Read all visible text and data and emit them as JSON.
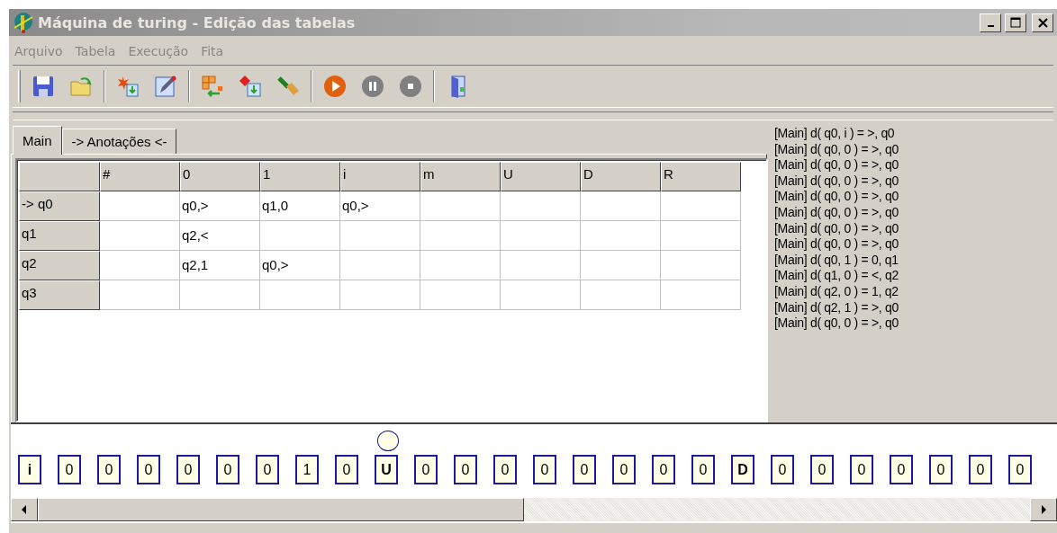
{
  "window": {
    "title": "Máquina de turing - Edição das tabelas"
  },
  "menu": [
    {
      "label": "Arquivo",
      "disabled": true
    },
    {
      "label": "Tabela",
      "disabled": true
    },
    {
      "label": "Execução",
      "disabled": true
    },
    {
      "label": "Fita",
      "disabled": true
    }
  ],
  "tabs": [
    {
      "label": "Main",
      "selected": true
    },
    {
      "label": "-> Anotações <-",
      "selected": false
    }
  ],
  "table": {
    "columns": [
      "#",
      "0",
      "1",
      "i",
      "m",
      "U",
      "D",
      "R"
    ],
    "rows": [
      {
        "state": "-> q0",
        "cells": [
          null,
          "q0,>",
          "q1,0",
          "q0,>",
          null,
          null,
          null,
          null
        ]
      },
      {
        "state": "q1",
        "cells": [
          null,
          "q2,<",
          null,
          null,
          null,
          null,
          null,
          null
        ]
      },
      {
        "state": "q2",
        "cells": [
          null,
          "q2,1",
          "q0,>",
          null,
          null,
          null,
          null,
          null
        ]
      },
      {
        "state": "q3",
        "cells": [
          null,
          null,
          null,
          null,
          null,
          null,
          null,
          null
        ]
      }
    ]
  },
  "log": [
    "[Main] d( q0, i ) = >, q0",
    "[Main] d( q0, 0 ) = >, q0",
    "[Main] d( q0, 0 ) = >, q0",
    "[Main] d( q0, 0 ) = >, q0",
    "[Main] d( q0, 0 ) = >, q0",
    "[Main] d( q0, 0 ) = >, q0",
    "[Main] d( q0, 0 ) = >, q0",
    "[Main] d( q0, 0 ) = >, q0",
    "[Main] d( q0, 1 ) = 0, q1",
    "[Main] d( q1, 0 ) = <, q2",
    "[Main] d( q2, 0 ) = 1, q2",
    "[Main] d( q2, 1 ) = >, q0",
    "[Main] d( q0, 0 ) = >, q0"
  ],
  "tape": [
    {
      "symbol": "i",
      "bold": true,
      "selected": false
    },
    {
      "symbol": "0",
      "bold": false,
      "selected": false
    },
    {
      "symbol": "0",
      "bold": false,
      "selected": false
    },
    {
      "symbol": "0",
      "bold": false,
      "selected": false
    },
    {
      "symbol": "0",
      "bold": false,
      "selected": false
    },
    {
      "symbol": "0",
      "bold": false,
      "selected": false
    },
    {
      "symbol": "0",
      "bold": false,
      "selected": false
    },
    {
      "symbol": "1",
      "bold": false,
      "selected": false
    },
    {
      "symbol": "0",
      "bold": false,
      "selected": false
    },
    {
      "symbol": "U",
      "bold": true,
      "selected": true
    },
    {
      "symbol": "0",
      "bold": false,
      "selected": false
    },
    {
      "symbol": "0",
      "bold": false,
      "selected": false
    },
    {
      "symbol": "0",
      "bold": false,
      "selected": false
    },
    {
      "symbol": "0",
      "bold": false,
      "selected": false
    },
    {
      "symbol": "0",
      "bold": false,
      "selected": false
    },
    {
      "symbol": "0",
      "bold": false,
      "selected": false
    },
    {
      "symbol": "0",
      "bold": false,
      "selected": false
    },
    {
      "symbol": "0",
      "bold": false,
      "selected": false
    },
    {
      "symbol": "D",
      "bold": true,
      "selected": false
    },
    {
      "symbol": "0",
      "bold": false,
      "selected": false
    },
    {
      "symbol": "0",
      "bold": false,
      "selected": false
    },
    {
      "symbol": "0",
      "bold": false,
      "selected": false
    },
    {
      "symbol": "0",
      "bold": false,
      "selected": false
    },
    {
      "symbol": "0",
      "bold": false,
      "selected": false
    },
    {
      "symbol": "0",
      "bold": false,
      "selected": false
    },
    {
      "symbol": "0",
      "bold": false,
      "selected": false
    }
  ]
}
